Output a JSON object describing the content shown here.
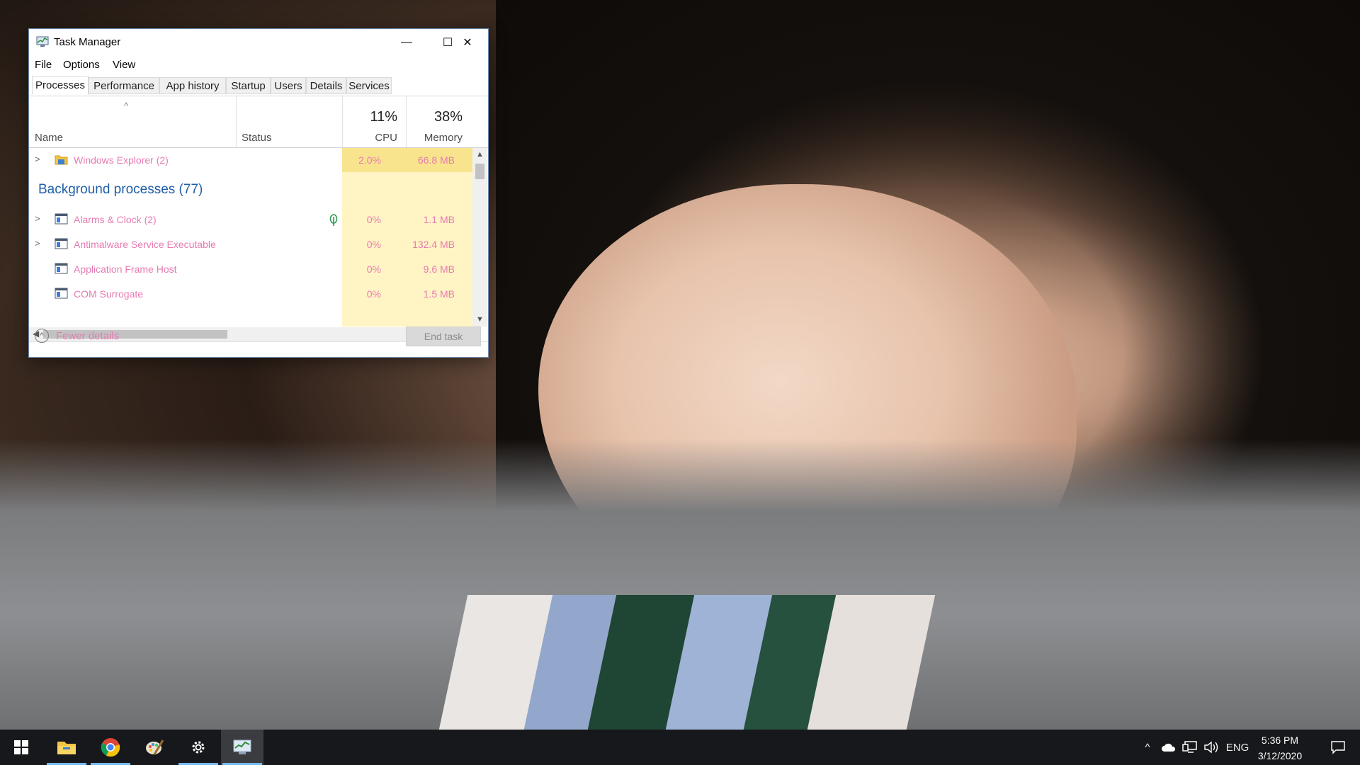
{
  "window": {
    "title": "Task Manager",
    "controls": {
      "minimize": "—",
      "maximize": "☐",
      "close": "✕"
    }
  },
  "menu": [
    "File",
    "Options",
    "View"
  ],
  "tabs": [
    "Processes",
    "Performance",
    "App history",
    "Startup",
    "Users",
    "Details",
    "Services"
  ],
  "columns": {
    "name": "Name",
    "status": "Status",
    "cpu_pct": "11%",
    "cpu": "CPU",
    "mem_pct": "38%",
    "memory": "Memory"
  },
  "processes": [
    {
      "name": "Windows Explorer (2)",
      "cpu": "2.0%",
      "memory": "66.8 MB",
      "expandable": true,
      "icon": "folder-icon"
    }
  ],
  "background": {
    "title": "Background processes (77)",
    "rows": [
      {
        "name": "Alarms & Clock (2)",
        "cpu": "0%",
        "memory": "1.1 MB",
        "expandable": true,
        "icon": "app-window-icon",
        "status_icon": "leaf-icon"
      },
      {
        "name": "Antimalware Service Executable",
        "cpu": "0%",
        "memory": "132.4 MB",
        "expandable": true,
        "icon": "app-window-icon"
      },
      {
        "name": "Application Frame Host",
        "cpu": "0%",
        "memory": "9.6 MB",
        "expandable": false,
        "icon": "app-window-icon"
      },
      {
        "name": "COM Surrogate",
        "cpu": "0%",
        "memory": "1.5 MB",
        "expandable": false,
        "icon": "app-window-icon"
      }
    ]
  },
  "footer": {
    "fewer_details": "Fewer details",
    "end_task": "End task"
  },
  "taskbar": {
    "apps": [
      "start-icon",
      "file-explorer-icon",
      "chrome-icon",
      "paint-icon",
      "settings-icon",
      "task-manager-icon"
    ],
    "tray": {
      "language": "ENG",
      "time": "5:36 PM",
      "date": "3/12/2020"
    }
  },
  "colors": {
    "accent": "#1f5ea8",
    "highlight_text": "#e67bb1",
    "usage_bg": "#fff4c4",
    "taskbar": "#17181b"
  }
}
